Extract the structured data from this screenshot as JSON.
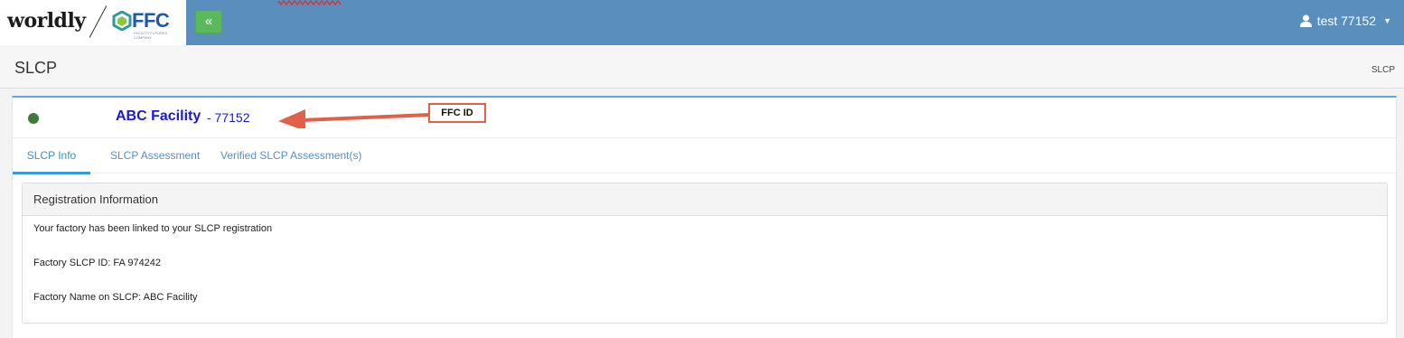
{
  "brand": {
    "worldly": "worldly",
    "ffc": "FFC",
    "ffc_tagline": "FACILITY FUTURES COMPANY"
  },
  "topbar": {
    "collapse_label": "«",
    "user_label": "test 77152",
    "user_icon": "user-icon",
    "caret_icon": "caret-down-icon",
    "bar_color": "#5a8fbd"
  },
  "page": {
    "title": "SLCP",
    "breadcrumb": "SLCP"
  },
  "facility": {
    "name": "ABC Facility",
    "id_text": "- 77152",
    "status_color": "#3f7a3c"
  },
  "annotation": {
    "label": "FFC ID",
    "color": "#e0604a"
  },
  "tabs": [
    {
      "label": "SLCP Info",
      "active": true
    },
    {
      "label": "SLCP Assessment",
      "active": false
    },
    {
      "label": "Verified SLCP Assessment(s)",
      "active": false
    }
  ],
  "registration": {
    "heading": "Registration Information",
    "linked_message": "Your factory has been linked to your SLCP registration",
    "slcp_id_line": "Factory SLCP ID: FA 974242",
    "name_line": "Factory Name on SLCP:  ABC Facility"
  }
}
